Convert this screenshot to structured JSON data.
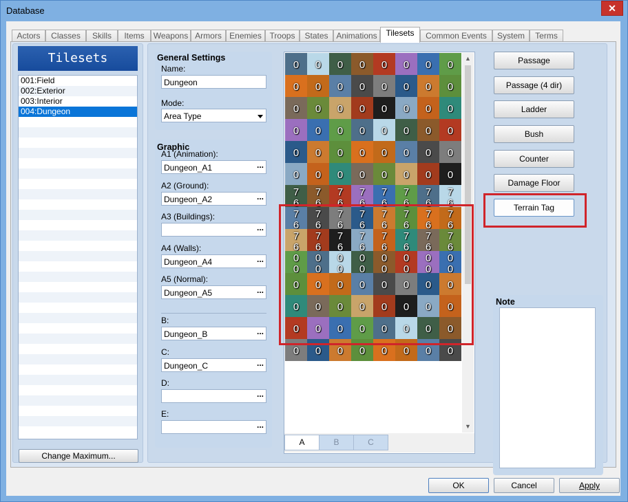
{
  "window": {
    "title": "Database",
    "close_glyph": "✕"
  },
  "tabs": [
    {
      "label": "Actors",
      "active": false
    },
    {
      "label": "Classes",
      "active": false
    },
    {
      "label": "Skills",
      "active": false
    },
    {
      "label": "Items",
      "active": false
    },
    {
      "label": "Weapons",
      "active": false
    },
    {
      "label": "Armors",
      "active": false
    },
    {
      "label": "Enemies",
      "active": false
    },
    {
      "label": "Troops",
      "active": false
    },
    {
      "label": "States",
      "active": false
    },
    {
      "label": "Animations",
      "active": false
    },
    {
      "label": "Tilesets",
      "active": true
    },
    {
      "label": "Common Events",
      "active": false
    },
    {
      "label": "System",
      "active": false
    },
    {
      "label": "Terms",
      "active": false
    }
  ],
  "tileset_list": {
    "header": "Tilesets",
    "items": [
      "001:Field",
      "002:Exterior",
      "003:Interior",
      "004:Dungeon"
    ],
    "selected_index": 3,
    "change_max_label": "Change Maximum..."
  },
  "general": {
    "title": "General Settings",
    "name_label": "Name:",
    "name_value": "Dungeon",
    "mode_label": "Mode:",
    "mode_value": "Area Type"
  },
  "graphic": {
    "title": "Graphic",
    "a1_label": "A1 (Animation):",
    "a1_value": "Dungeon_A1",
    "a2_label": "A2 (Ground):",
    "a2_value": "Dungeon_A2",
    "a3_label": "A3 (Buildings):",
    "a3_value": "",
    "a4_label": "A4 (Walls):",
    "a4_value": "Dungeon_A4",
    "a5_label": "A5 (Normal):",
    "a5_value": "Dungeon_A5",
    "b_label": "B:",
    "b_value": "Dungeon_B",
    "c_label": "C:",
    "c_value": "Dungeon_C",
    "d_label": "D:",
    "d_value": "",
    "e_label": "E:",
    "e_value": "",
    "browse_glyph": "..."
  },
  "tile_palette": {
    "rows": [
      [
        "0",
        "0",
        "0",
        "0",
        "0",
        "0",
        "0",
        "0"
      ],
      [
        "0",
        "0",
        "0",
        "0",
        "0",
        "0",
        "0",
        "0"
      ],
      [
        "0",
        "0",
        "0",
        "0",
        "0",
        "0",
        "0",
        "0"
      ],
      [
        "0",
        "0",
        "0",
        "0",
        "0",
        "0",
        "0",
        "0"
      ],
      [
        "0",
        "0",
        "0",
        "0",
        "0",
        "0",
        "0",
        "0"
      ],
      [
        "0",
        "0",
        "0",
        "0",
        "0",
        "0",
        "0",
        "0"
      ],
      [
        "7/6",
        "7/6",
        "7/6",
        "7/6",
        "7/6",
        "7/6",
        "7/6",
        "7/6"
      ],
      [
        "7/6",
        "7/6",
        "7/6",
        "7/6",
        "7/6",
        "7/6",
        "7/6",
        "7/6"
      ],
      [
        "7/6",
        "7/6",
        "7/6",
        "7/6",
        "7/6",
        "7/6",
        "7/6",
        "7/6"
      ],
      [
        "0/0",
        "0/0",
        "0/0",
        "0/0",
        "0/0",
        "0/0",
        "0/0",
        "0/0"
      ],
      [
        "0",
        "0",
        "0",
        "0",
        "0",
        "0",
        "0",
        "0"
      ],
      [
        "0",
        "0",
        "0",
        "0",
        "0",
        "0",
        "0",
        "0"
      ],
      [
        "0",
        "0",
        "0",
        "0",
        "0",
        "0",
        "0",
        "0"
      ],
      [
        "0",
        "0",
        "0",
        "0",
        "0",
        "0",
        "0",
        "0"
      ]
    ],
    "subtabs": [
      {
        "label": "A",
        "active": true
      },
      {
        "label": "B",
        "active": false
      },
      {
        "label": "C",
        "active": false
      }
    ]
  },
  "modes": [
    {
      "label": "Passage",
      "highlighted": false
    },
    {
      "label": "Passage (4 dir)",
      "highlighted": false
    },
    {
      "label": "Ladder",
      "highlighted": false
    },
    {
      "label": "Bush",
      "highlighted": false
    },
    {
      "label": "Counter",
      "highlighted": false
    },
    {
      "label": "Damage Floor",
      "highlighted": false
    },
    {
      "label": "Terrain Tag",
      "highlighted": true
    }
  ],
  "note": {
    "label": "Note",
    "value": ""
  },
  "footer": {
    "ok_label": "OK",
    "cancel_label": "Cancel",
    "apply_label": "Apply"
  },
  "colors": {
    "highlight": "#d0242a",
    "selection": "#0a75d8",
    "header": "#1f55a6"
  }
}
